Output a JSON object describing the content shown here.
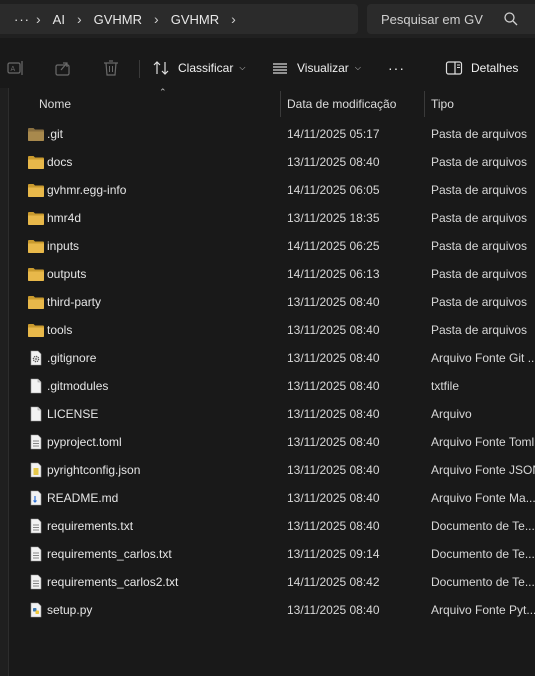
{
  "address": {
    "more_label": "···",
    "crumbs": [
      "AI",
      "GVHMR",
      "GVHMR"
    ],
    "sep": "›",
    "search_placeholder": "Pesquisar em GV"
  },
  "toolbar": {
    "sort_label": "Classificar",
    "view_label": "Visualizar",
    "more_label": "···",
    "details_label": "Detalhes"
  },
  "columns": {
    "name": "Nome",
    "date": "Data de modificação",
    "type": "Tipo"
  },
  "files": [
    {
      "name": ".git",
      "date": "14/11/2025 05:17",
      "type": "Pasta de arquivos",
      "icon": "folder-icon"
    },
    {
      "name": "docs",
      "date": "13/11/2025 08:40",
      "type": "Pasta de arquivos",
      "icon": "folder-icon"
    },
    {
      "name": "gvhmr.egg-info",
      "date": "14/11/2025 06:05",
      "type": "Pasta de arquivos",
      "icon": "folder-icon"
    },
    {
      "name": "hmr4d",
      "date": "13/11/2025 18:35",
      "type": "Pasta de arquivos",
      "icon": "folder-icon"
    },
    {
      "name": "inputs",
      "date": "14/11/2025 06:25",
      "type": "Pasta de arquivos",
      "icon": "folder-icon"
    },
    {
      "name": "outputs",
      "date": "14/11/2025 06:13",
      "type": "Pasta de arquivos",
      "icon": "folder-icon"
    },
    {
      "name": "third-party",
      "date": "13/11/2025 08:40",
      "type": "Pasta de arquivos",
      "icon": "folder-icon"
    },
    {
      "name": "tools",
      "date": "13/11/2025 08:40",
      "type": "Pasta de arquivos",
      "icon": "folder-icon"
    },
    {
      "name": ".gitignore",
      "date": "13/11/2025 08:40",
      "type": "Arquivo Fonte Git ...",
      "icon": "gear-file-icon"
    },
    {
      "name": ".gitmodules",
      "date": "13/11/2025 08:40",
      "type": "txtfile",
      "icon": "file-icon"
    },
    {
      "name": "LICENSE",
      "date": "13/11/2025 08:40",
      "type": "Arquivo",
      "icon": "file-icon"
    },
    {
      "name": "pyproject.toml",
      "date": "13/11/2025 08:40",
      "type": "Arquivo Fonte Toml",
      "icon": "text-file-icon"
    },
    {
      "name": "pyrightconfig.json",
      "date": "13/11/2025 08:40",
      "type": "Arquivo Fonte JSON",
      "icon": "json-file-icon"
    },
    {
      "name": "README.md",
      "date": "13/11/2025 08:40",
      "type": "Arquivo Fonte Ma...",
      "icon": "markdown-file-icon"
    },
    {
      "name": "requirements.txt",
      "date": "13/11/2025 08:40",
      "type": "Documento de Te...",
      "icon": "text-file-icon"
    },
    {
      "name": "requirements_carlos.txt",
      "date": "13/11/2025 09:14",
      "type": "Documento de Te...",
      "icon": "text-file-icon"
    },
    {
      "name": "requirements_carlos2.txt",
      "date": "14/11/2025 08:42",
      "type": "Documento de Te...",
      "icon": "text-file-icon"
    },
    {
      "name": "setup.py",
      "date": "13/11/2025 08:40",
      "type": "Arquivo Fonte Pyt...",
      "icon": "python-file-icon"
    }
  ],
  "colors": {
    "folder": "#e8b84a",
    "folder_dark": "#c99a2e",
    "git_folder": "#a8894d",
    "background": "#191919"
  }
}
